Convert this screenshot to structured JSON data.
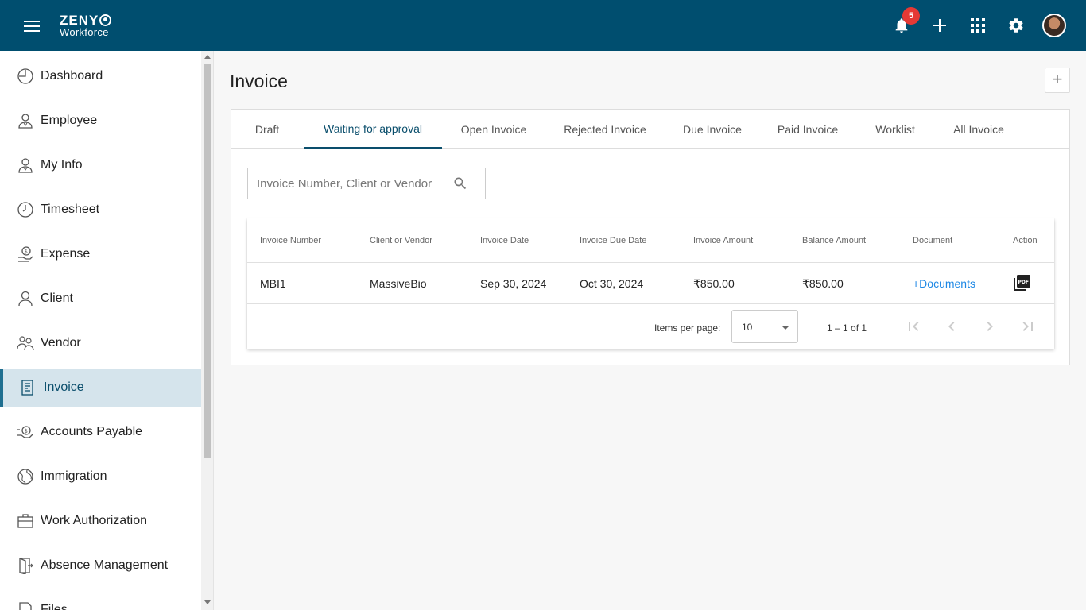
{
  "header": {
    "logo_top": "ZENY",
    "logo_bottom": "Workforce",
    "notification_count": "5",
    "icons": [
      "menu-icon",
      "bell-icon",
      "plus-icon",
      "apps-grid-icon",
      "gear-icon",
      "avatar"
    ]
  },
  "sidebar": {
    "items": [
      {
        "label": "Dashboard",
        "icon": "dashboard-icon"
      },
      {
        "label": "Employee",
        "icon": "employee-icon"
      },
      {
        "label": "My Info",
        "icon": "my-info-icon"
      },
      {
        "label": "Timesheet",
        "icon": "clock-icon"
      },
      {
        "label": "Expense",
        "icon": "expense-icon"
      },
      {
        "label": "Client",
        "icon": "client-icon"
      },
      {
        "label": "Vendor",
        "icon": "vendor-icon"
      },
      {
        "label": "Invoice",
        "icon": "invoice-icon",
        "active": true
      },
      {
        "label": "Accounts Payable",
        "icon": "accounts-payable-icon"
      },
      {
        "label": "Immigration",
        "icon": "globe-icon"
      },
      {
        "label": "Work Authorization",
        "icon": "briefcase-icon"
      },
      {
        "label": "Absence Management",
        "icon": "door-icon"
      },
      {
        "label": "Files",
        "icon": "files-icon"
      }
    ]
  },
  "main": {
    "title": "Invoice",
    "add_button": "+",
    "tabs": [
      {
        "label": "Draft"
      },
      {
        "label": "Waiting for approval",
        "active": true
      },
      {
        "label": "Open Invoice"
      },
      {
        "label": "Rejected Invoice"
      },
      {
        "label": "Due Invoice"
      },
      {
        "label": "Paid Invoice"
      },
      {
        "label": "Worklist"
      },
      {
        "label": "All Invoice"
      }
    ],
    "search": {
      "placeholder": "Invoice Number, Client or Vendor"
    },
    "table": {
      "columns": [
        "Invoice Number",
        "Client or Vendor",
        "Invoice Date",
        "Invoice Due Date",
        "Invoice Amount",
        "Balance Amount",
        "Document",
        "Action"
      ],
      "rows": [
        {
          "invoice_number": "MBI1",
          "client": "MassiveBio",
          "invoice_date": "Sep 30, 2024",
          "due_date": "Oct 30, 2024",
          "amount": "₹850.00",
          "balance": "₹850.00",
          "document": "+Documents",
          "action_icon": "pdf-icon"
        }
      ]
    },
    "paginator": {
      "items_per_page_label": "Items per page:",
      "items_per_page_value": "10",
      "range": "1 – 1 of 1"
    }
  },
  "colors": {
    "header_bg": "#004e6f",
    "accent": "#0a4e6c",
    "badge": "#e53935",
    "link": "#1e88e5",
    "active_item_bg": "#d5e4ec",
    "logo_orange": "#f08a24"
  }
}
